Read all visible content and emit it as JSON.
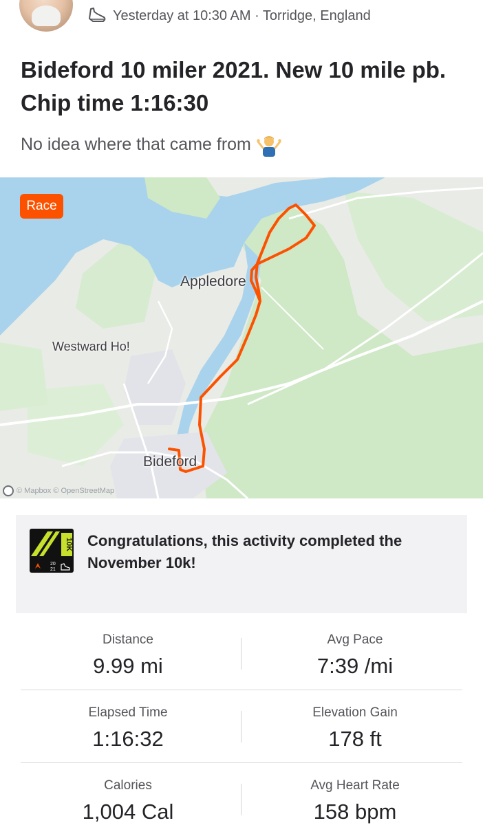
{
  "header": {
    "activity_icon": "shoe-icon",
    "meta": "Yesterday at 10:30 AM · Torridge, England"
  },
  "activity": {
    "title": "Bideford 10 miler 2021. New 10 mile pb. Chip time 1:16:30",
    "description": "No idea where that came from",
    "description_emoji": "person-shrugging-emoji"
  },
  "map": {
    "badge": "Race",
    "route_color": "#fc5200",
    "places": {
      "appledore": "Appledore",
      "westward_ho": "Westward Ho!",
      "bideford": "Bideford"
    },
    "attribution": "© Mapbox © OpenStreetMap"
  },
  "challenge": {
    "icon": "november-10k-badge-icon",
    "text": "Congratulations, this activity completed the November 10k!"
  },
  "stats": [
    [
      {
        "label": "Distance",
        "value": "9.99 mi"
      },
      {
        "label": "Avg Pace",
        "value": "7:39 /mi"
      }
    ],
    [
      {
        "label": "Elapsed Time",
        "value": "1:16:32"
      },
      {
        "label": "Elevation Gain",
        "value": "178 ft"
      }
    ],
    [
      {
        "label": "Calories",
        "value": "1,004 Cal"
      },
      {
        "label": "Avg Heart Rate",
        "value": "158 bpm"
      }
    ]
  ],
  "colors": {
    "brand": "#fc5200",
    "text_primary": "#242428",
    "text_secondary": "#55555a",
    "water": "#a9d3ec",
    "land": "#e9ebe6",
    "park": "#cfe8c6"
  }
}
